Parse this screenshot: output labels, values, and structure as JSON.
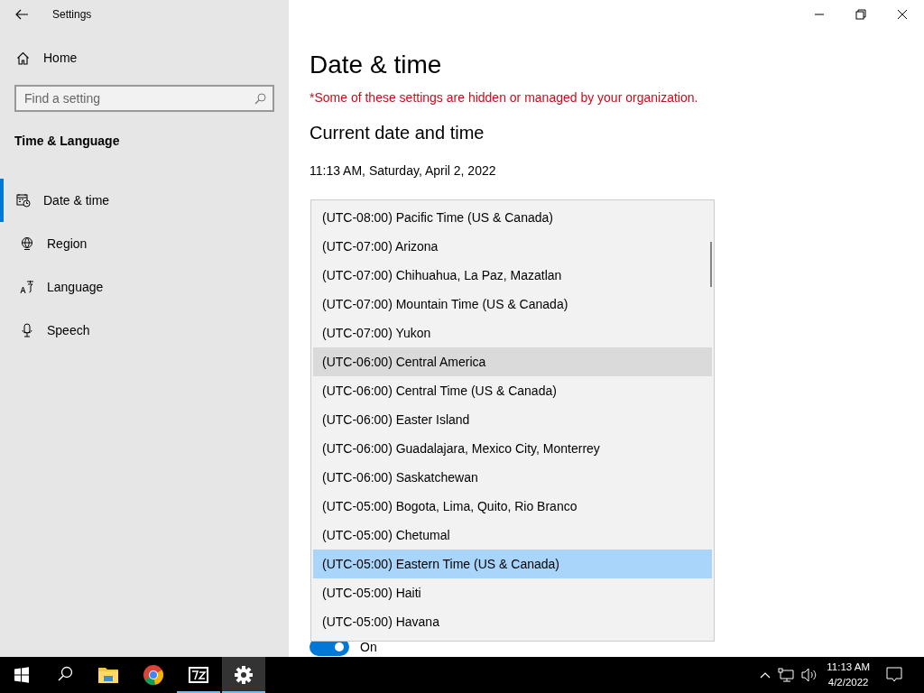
{
  "window": {
    "title": "Settings"
  },
  "sidebar": {
    "home": "Home",
    "search": {
      "placeholder": "Find a setting"
    },
    "section": "Time & Language",
    "items": [
      {
        "label": "Date & time",
        "selected": true
      },
      {
        "label": "Region",
        "selected": false
      },
      {
        "label": "Language",
        "selected": false
      },
      {
        "label": "Speech",
        "selected": false
      }
    ]
  },
  "page": {
    "title": "Date & time",
    "notice": "*Some of these settings are hidden or managed by your organization.",
    "heading": "Current date and time",
    "current_datetime": "11:13 AM, Saturday, April 2, 2022",
    "toggle": {
      "label": "On",
      "on": true
    },
    "timezone_list": [
      {
        "label": "(UTC-08:00) Pacific Time (US & Canada)",
        "selected": false,
        "hovered": false
      },
      {
        "label": "(UTC-07:00) Arizona",
        "selected": false,
        "hovered": false
      },
      {
        "label": "(UTC-07:00) Chihuahua, La Paz, Mazatlan",
        "selected": false,
        "hovered": false
      },
      {
        "label": "(UTC-07:00) Mountain Time (US & Canada)",
        "selected": false,
        "hovered": false
      },
      {
        "label": "(UTC-07:00) Yukon",
        "selected": false,
        "hovered": false
      },
      {
        "label": "(UTC-06:00) Central America",
        "selected": false,
        "hovered": true
      },
      {
        "label": "(UTC-06:00) Central Time (US & Canada)",
        "selected": false,
        "hovered": false
      },
      {
        "label": "(UTC-06:00) Easter Island",
        "selected": false,
        "hovered": false
      },
      {
        "label": "(UTC-06:00) Guadalajara, Mexico City, Monterrey",
        "selected": false,
        "hovered": false
      },
      {
        "label": "(UTC-06:00) Saskatchewan",
        "selected": false,
        "hovered": false
      },
      {
        "label": "(UTC-05:00) Bogota, Lima, Quito, Rio Branco",
        "selected": false,
        "hovered": false
      },
      {
        "label": "(UTC-05:00) Chetumal",
        "selected": false,
        "hovered": false
      },
      {
        "label": "(UTC-05:00) Eastern Time (US & Canada)",
        "selected": true,
        "hovered": false
      },
      {
        "label": "(UTC-05:00) Haiti",
        "selected": false,
        "hovered": false
      },
      {
        "label": "(UTC-05:00) Havana",
        "selected": false,
        "hovered": false
      }
    ]
  },
  "taskbar": {
    "apps": [
      {
        "running": false,
        "active": false
      },
      {
        "running": false,
        "active": false
      },
      {
        "running": true,
        "active": false
      },
      {
        "running": true,
        "active": true
      }
    ],
    "clock": {
      "time": "11:13 AM",
      "date": "4/2/2022"
    }
  }
}
